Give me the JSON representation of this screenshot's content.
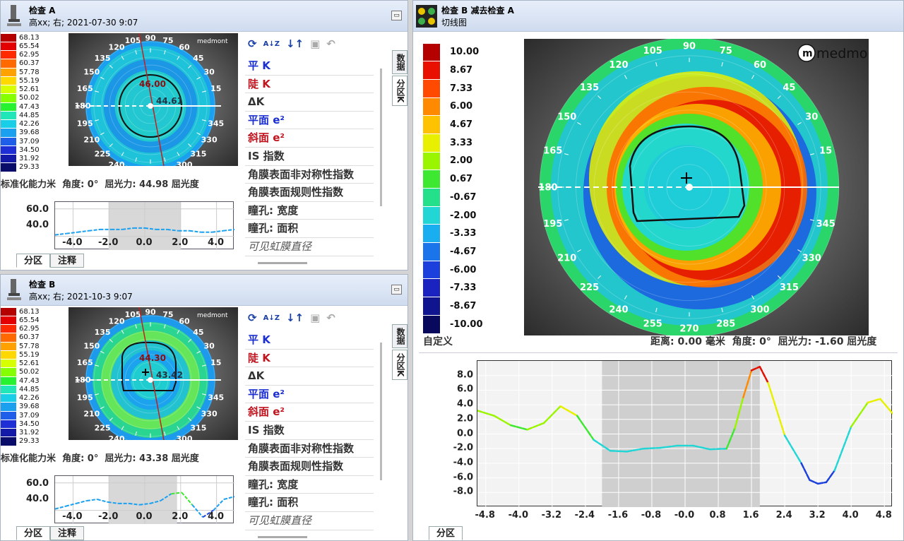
{
  "panel_a": {
    "title": "检查 A",
    "subtitle": "高xx; 右; 2021-07-30 9:07",
    "stat_label": "标准化能力米",
    "angle_text": "角度: 0°",
    "power_text": "屈光力: 44.98 屈光度",
    "center_value": "46.00",
    "side_value": "44.61",
    "sparkline": {
      "yticks": [
        "60.0",
        "40.0"
      ],
      "xticks": [
        "-4.0",
        "-2.0",
        "0.0",
        "2.0",
        "4.0"
      ],
      "profile": [
        41,
        42,
        43,
        44,
        45,
        45,
        45,
        46,
        46,
        45,
        45,
        44,
        44,
        43,
        43,
        44,
        45
      ],
      "x_range": [
        -5,
        5
      ],
      "y_range": [
        30,
        65
      ]
    }
  },
  "panel_b": {
    "title": "检查 B",
    "subtitle": "高xx; 右; 2021-10-3 9:07",
    "stat_label": "标准化能力米",
    "angle_text": "角度: 0°",
    "power_text": "屈光力: 43.38 屈光度",
    "center_value": "44.30",
    "side_value": "43.42",
    "sparkline": {
      "yticks": [
        "60.0",
        "40.0"
      ],
      "xticks": [
        "-4.0",
        "-2.0",
        "0.0",
        "2.0",
        "4.0"
      ],
      "profile": [
        41,
        43,
        45,
        47,
        48,
        46,
        45,
        45,
        44,
        45,
        47,
        52,
        53,
        44,
        35,
        40,
        48,
        50
      ],
      "x_range": [
        -5,
        5
      ],
      "y_range": [
        30,
        65
      ]
    }
  },
  "abs_legend": [
    "68.13",
    "65.54",
    "62.95",
    "60.37",
    "57.78",
    "55.19",
    "52.61",
    "50.02",
    "47.43",
    "44.85",
    "42.26",
    "39.68",
    "37.09",
    "34.50",
    "31.92",
    "29.33"
  ],
  "abs_colors": [
    "#b50000",
    "#e20000",
    "#ff2a00",
    "#ff6a00",
    "#ffa200",
    "#ffd800",
    "#d8ff00",
    "#86ff00",
    "#27f230",
    "#20e6b8",
    "#19cfe8",
    "#1ba0f0",
    "#1f5ee8",
    "#1e2fd6",
    "#141aa8",
    "#0a0c6a"
  ],
  "angle_labels": [
    "105",
    "90",
    "75",
    "120",
    "60",
    "135",
    "45",
    "150",
    "30",
    "165",
    "15",
    "180",
    "195",
    "345",
    "210",
    "330",
    "225",
    "315",
    "240",
    "300",
    "255",
    "270",
    "285"
  ],
  "data_list": {
    "flat_k": "平 K",
    "steep_k": "陡 K",
    "delta_k": "ΔK",
    "flat_e": "平面 e²",
    "steep_e": "斜面 e²",
    "is_index": "IS 指数",
    "asym_index": "角膜表面非对称性指数",
    "reg_index": "角膜表面规则性指数",
    "pupil_width": "瞳孔: 宽度",
    "pupil_area": "瞳孔: 面积",
    "visible_iris": "可见虹膜直径"
  },
  "tabs": {
    "data": "数据",
    "zone_k": "分区K",
    "zones": "分区",
    "notes": "注释"
  },
  "right": {
    "title": "检查 B 减去检查 A",
    "subtitle": "切线图",
    "brand": "medmont",
    "logo_letter": "m",
    "legend": [
      "10.00",
      "8.67",
      "7.33",
      "6.00",
      "4.67",
      "3.33",
      "2.00",
      "0.67",
      "-0.67",
      "-2.00",
      "-3.33",
      "-4.67",
      "-6.00",
      "-7.33",
      "-8.67",
      "-10.00"
    ],
    "legend_colors": [
      "#b50000",
      "#e81000",
      "#ff4a00",
      "#ff8a00",
      "#ffc200",
      "#e8f000",
      "#9cf500",
      "#3ee830",
      "#25e08a",
      "#22d6d6",
      "#18aef0",
      "#1a75ea",
      "#1c40dc",
      "#1a22c0",
      "#10148e",
      "#08085c"
    ],
    "custom_label": "自定义",
    "dist_text": "距离: 0.00 毫米",
    "angle_text": "角度: 0°",
    "power_text": "屈光力: -1.60 屈光度",
    "zone_tab": "分区"
  },
  "chart_data": {
    "type": "line",
    "title": "",
    "xlabel": "",
    "ylabel": "",
    "x": [
      -5.0,
      -4.6,
      -4.2,
      -3.8,
      -3.4,
      -3.0,
      -2.6,
      -2.2,
      -1.8,
      -1.4,
      -1.0,
      -0.6,
      -0.2,
      0.2,
      0.6,
      1.0,
      1.2,
      1.4,
      1.6,
      1.8,
      2.0,
      2.4,
      2.8,
      3.0,
      3.2,
      3.4,
      3.6,
      4.0,
      4.4,
      4.7,
      5.0
    ],
    "y": [
      3.2,
      2.5,
      1.2,
      0.6,
      1.5,
      3.8,
      2.5,
      -0.8,
      -2.3,
      -2.4,
      -2.0,
      -1.9,
      -1.6,
      -1.6,
      -2.1,
      -2.0,
      0.8,
      5.0,
      8.7,
      9.2,
      7.0,
      -0.2,
      -4.0,
      -6.3,
      -6.8,
      -6.6,
      -5.0,
      1.0,
      4.3,
      4.8,
      2.8
    ],
    "xlim": [
      -5.0,
      5.0
    ],
    "ylim": [
      -10.0,
      10.0
    ],
    "xticks": [
      "-4.8",
      "-4.0",
      "-3.2",
      "-2.4",
      "-1.6",
      "-0.8",
      "-0.0",
      "0.8",
      "1.6",
      "2.4",
      "3.2",
      "4.0",
      "4.8"
    ],
    "yticks": [
      "8.0",
      "6.0",
      "4.0",
      "2.0",
      "0.0",
      "-2.0",
      "-4.0",
      "-6.0",
      "-8.0"
    ],
    "grid": true,
    "shaded_region": [
      -2.0,
      1.8
    ]
  }
}
